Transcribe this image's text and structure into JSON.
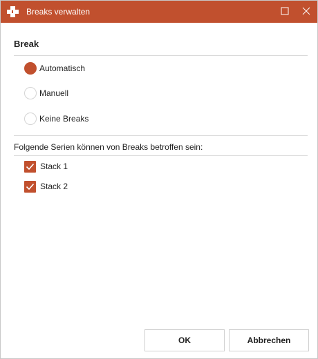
{
  "window": {
    "title": "Breaks verwalten",
    "accent_color": "#c1502e",
    "controls": {
      "maximize_icon": "maximize-icon",
      "close_icon": "close-icon"
    }
  },
  "break_section": {
    "title": "Break",
    "options": [
      {
        "label": "Automatisch",
        "checked": true
      },
      {
        "label": "Manuell",
        "checked": false
      },
      {
        "label": "Keine Breaks",
        "checked": false
      }
    ]
  },
  "series_section": {
    "label": "Folgende Serien können von Breaks betroffen sein:",
    "items": [
      {
        "label": "Stack 1",
        "checked": true
      },
      {
        "label": "Stack 2",
        "checked": true
      }
    ]
  },
  "buttons": {
    "ok": "OK",
    "cancel": "Abbrechen"
  }
}
